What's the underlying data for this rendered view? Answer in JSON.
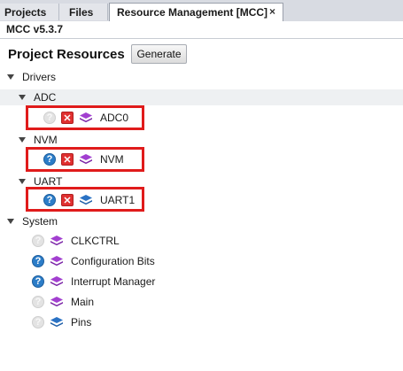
{
  "tabs": [
    {
      "label": "Projects",
      "active": false
    },
    {
      "label": "Files",
      "active": false
    },
    {
      "label": "Resource Management [MCC]",
      "active": true,
      "close_symbol": "×"
    }
  ],
  "version": "MCC v5.3.7",
  "header": {
    "title": "Project Resources",
    "generate_label": "Generate"
  },
  "tree": {
    "drivers_label": "Drivers",
    "adc": {
      "label": "ADC",
      "item": {
        "label": "ADC0",
        "help_icon": "help-icon-disabled",
        "remove_icon": "remove-icon",
        "module_icon": "stack-icon-purple"
      }
    },
    "nvm": {
      "label": "NVM",
      "item": {
        "label": "NVM",
        "help_icon": "help-icon-active",
        "remove_icon": "remove-icon",
        "module_icon": "stack-icon-purple"
      }
    },
    "uart": {
      "label": "UART",
      "item": {
        "label": "UART1",
        "help_icon": "help-icon-active",
        "remove_icon": "remove-icon",
        "module_icon": "stack-icon-blue"
      }
    },
    "system_label": "System",
    "system_items": [
      {
        "label": "CLKCTRL",
        "help": "disabled",
        "color": "purple"
      },
      {
        "label": "Configuration Bits",
        "help": "active",
        "color": "purple"
      },
      {
        "label": "Interrupt Manager",
        "help": "active",
        "color": "purple"
      },
      {
        "label": "Main",
        "help": "disabled",
        "color": "purple"
      },
      {
        "label": "Pins",
        "help": "disabled",
        "color": "blue"
      }
    ]
  },
  "colors": {
    "highlight": "#e01b1b",
    "purple_stack": "#a23fd0",
    "blue_stack": "#1f5fa8",
    "help_blue": "#2c7dc8",
    "remove_red": "#e03030"
  }
}
